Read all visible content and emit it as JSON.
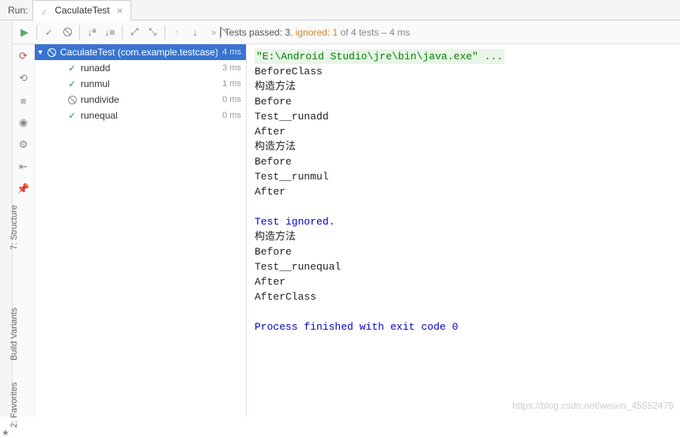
{
  "header": {
    "run_label": "Run:",
    "tab_name": "CaculateTest",
    "tab_close": "×"
  },
  "status": {
    "tests_passed_prefix": "Tests passed: ",
    "passed_count": "3",
    "ignored_prefix": ", ",
    "ignored_label": "ignored: 1",
    "rest": " of 4 tests – 4 ms"
  },
  "tree": {
    "root_label": "CaculateTest (com.example.testcase)",
    "root_time": "4 ms",
    "items": [
      {
        "icon": "check",
        "label": "runadd",
        "time": "3 ms"
      },
      {
        "icon": "check",
        "label": "runmul",
        "time": "1 ms"
      },
      {
        "icon": "ban",
        "label": "rundivide",
        "time": "0 ms"
      },
      {
        "icon": "check",
        "label": "runequal",
        "time": "0 ms"
      }
    ]
  },
  "console": {
    "lines": [
      {
        "cls": "c-green",
        "text": "\"E:\\Android Studio\\jre\\bin\\java.exe\" ..."
      },
      {
        "cls": "",
        "text": "BeforeClass"
      },
      {
        "cls": "",
        "text": "构造方法"
      },
      {
        "cls": "",
        "text": "Before"
      },
      {
        "cls": "",
        "text": "Test__runadd"
      },
      {
        "cls": "",
        "text": "After"
      },
      {
        "cls": "",
        "text": "构造方法"
      },
      {
        "cls": "",
        "text": "Before"
      },
      {
        "cls": "",
        "text": "Test__runmul"
      },
      {
        "cls": "",
        "text": "After"
      },
      {
        "cls": "",
        "text": ""
      },
      {
        "cls": "c-blue",
        "text": "Test ignored."
      },
      {
        "cls": "",
        "text": "构造方法"
      },
      {
        "cls": "",
        "text": "Before"
      },
      {
        "cls": "",
        "text": "Test__runequal"
      },
      {
        "cls": "",
        "text": "After"
      },
      {
        "cls": "",
        "text": "AfterClass"
      },
      {
        "cls": "",
        "text": ""
      },
      {
        "cls": "c-blue",
        "text": "Process finished with exit code 0"
      }
    ]
  },
  "gutter": {
    "structure": "7: Structure",
    "variants": "Build Variants",
    "favorites": "2: Favorites"
  },
  "watermark": "https://blog.csdn.net/weixin_45552475"
}
